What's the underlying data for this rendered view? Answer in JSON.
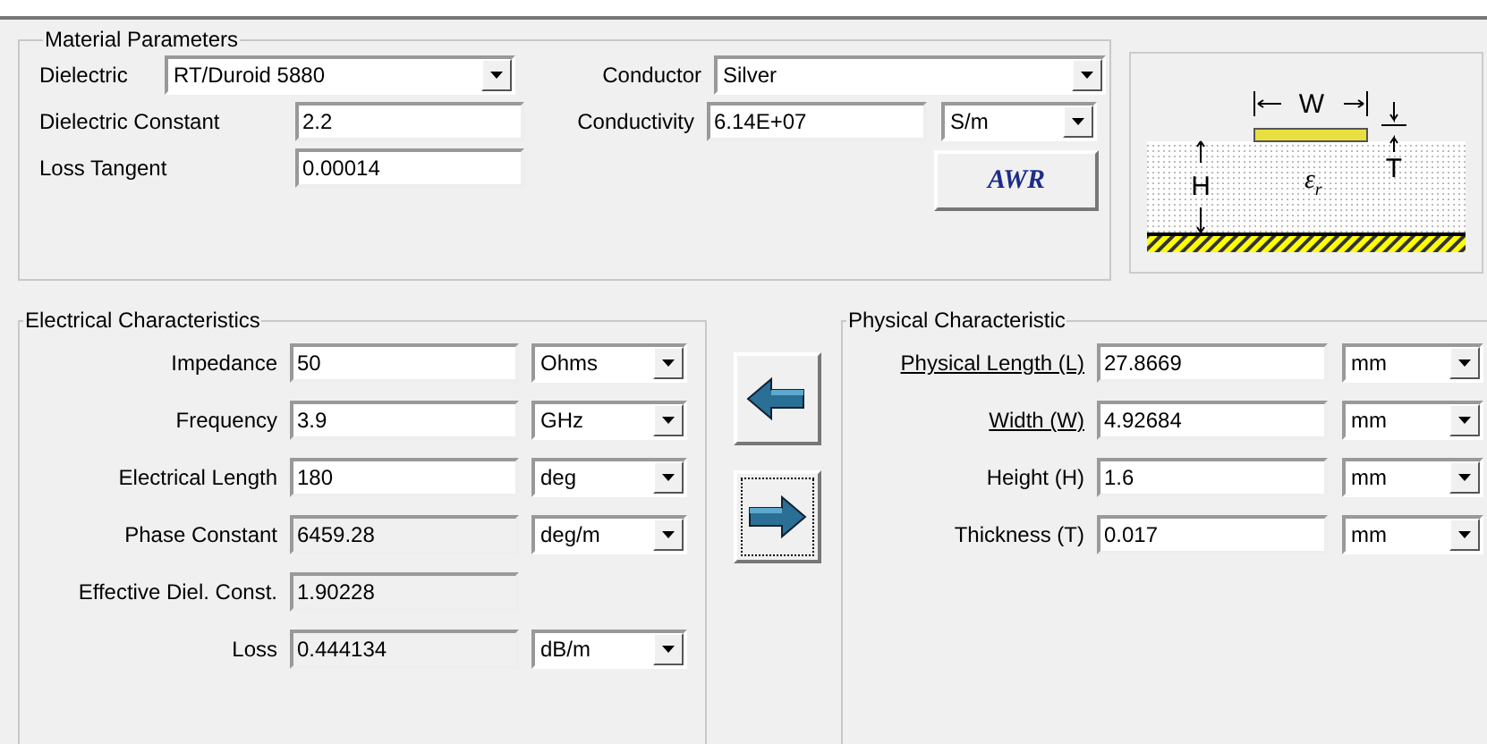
{
  "material_parameters": {
    "title": "Material Parameters",
    "dielectric": {
      "label": "Dielectric",
      "value": "RT/Duroid 5880"
    },
    "conductor": {
      "label": "Conductor",
      "value": "Silver"
    },
    "dielectric_constant": {
      "label": "Dielectric Constant",
      "value": "2.2"
    },
    "conductivity": {
      "label": "Conductivity",
      "value": "6.14E+07",
      "unit": "S/m"
    },
    "loss_tangent": {
      "label": "Loss Tangent",
      "value": "0.00014"
    },
    "logo_button": "AWR"
  },
  "diagram": {
    "width_label": "W",
    "height_label": "H",
    "thickness_label": "T",
    "permittivity": {
      "symbol": "ε",
      "subscript": "r"
    }
  },
  "electrical_characteristics": {
    "title": "Electrical Characteristics",
    "rows": [
      {
        "label": "Impedance",
        "value": "50",
        "unit": "Ohms",
        "readonly": false
      },
      {
        "label": "Frequency",
        "value": "3.9",
        "unit": "GHz",
        "readonly": false
      },
      {
        "label": "Electrical Length",
        "value": "180",
        "unit": "deg",
        "readonly": false
      },
      {
        "label": "Phase Constant",
        "value": "6459.28",
        "unit": "deg/m",
        "readonly": true
      },
      {
        "label": "Effective Diel. Const.",
        "value": "1.90228",
        "readonly": true
      },
      {
        "label": "Loss",
        "value": "0.444134",
        "unit": "dB/m",
        "readonly": true
      }
    ]
  },
  "arrow_buttons": [
    {
      "kind": "left",
      "focused": false
    },
    {
      "kind": "right",
      "focused": true
    }
  ],
  "physical_characteristic": {
    "title": "Physical Characteristic",
    "rows": [
      {
        "label": "Physical Length (L)",
        "value": "27.8669",
        "unit": "mm",
        "underlined": true
      },
      {
        "label": "Width (W)",
        "value": "4.92684",
        "unit": "mm",
        "underlined": true
      },
      {
        "label": "Height (H)",
        "value": "1.6",
        "unit": "mm",
        "underlined": false
      },
      {
        "label": "Thickness (T)",
        "value": "0.017",
        "unit": "mm",
        "underlined": false
      }
    ]
  }
}
